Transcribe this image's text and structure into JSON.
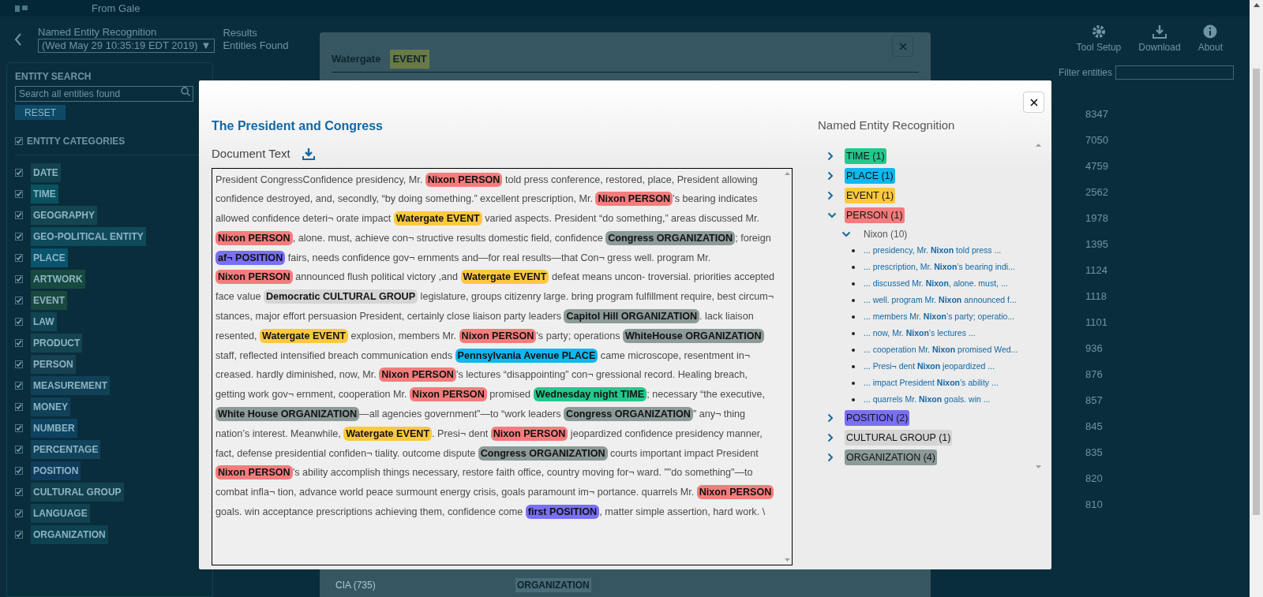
{
  "header": {
    "brand": "From Gale"
  },
  "toolbar": {
    "title": "Named Entity Recognition",
    "date_select": "(Wed May 29 10:35:19 EDT 2019)",
    "date_caret": "▼",
    "results_label": "Results",
    "results_sub": "Entities Found",
    "buttons": [
      {
        "label": "Tool Setup",
        "kind": "gear"
      },
      {
        "label": "Download",
        "kind": "download"
      },
      {
        "label": "About",
        "kind": "info"
      }
    ]
  },
  "sidebar": {
    "search_heading": "ENTITY SEARCH",
    "search": {
      "placeholder": "Search all entities found"
    },
    "reset": "RESET",
    "categories_heading": {
      "label": "ENTITY CATEGORIES",
      "checked": true
    },
    "categories": [
      {
        "label": "DATE",
        "checked": true,
        "color": "#12424c"
      },
      {
        "label": "TIME",
        "checked": true,
        "color": "#0b5261"
      },
      {
        "label": "GEOGRAPHY",
        "checked": true,
        "color": "#14464f"
      },
      {
        "label": "GEO-POLITICAL ENTITY",
        "checked": true,
        "color": "#0e4a5a"
      },
      {
        "label": "PLACE",
        "checked": true,
        "color": "#0a536c"
      },
      {
        "label": "ARTWORK",
        "checked": true,
        "color": "#17493f"
      },
      {
        "label": "EVENT",
        "checked": true,
        "color": "#1a473e"
      },
      {
        "label": "LAW",
        "checked": true,
        "color": "#114452"
      },
      {
        "label": "PRODUCT",
        "checked": true,
        "color": "#14444f"
      },
      {
        "label": "PERSON",
        "checked": true,
        "color": "#174050"
      },
      {
        "label": "MEASUREMENT",
        "checked": true,
        "color": "#114156"
      },
      {
        "label": "MONEY",
        "checked": true,
        "color": "#0f4159"
      },
      {
        "label": "NUMBER",
        "checked": true,
        "color": "#0c425f"
      },
      {
        "label": "PERCENTAGE",
        "checked": true,
        "color": "#11435a"
      },
      {
        "label": "POSITION",
        "checked": true,
        "color": "#0f3b5d"
      },
      {
        "label": "CULTURAL GROUP",
        "checked": true,
        "color": "#13414c"
      },
      {
        "label": "LANGUAGE",
        "checked": true,
        "color": "#12414f"
      },
      {
        "label": "ORGANIZATION",
        "checked": true,
        "color": "#0d4251"
      }
    ]
  },
  "results": {
    "filter_label": "Filter entities",
    "counts": [
      "8347",
      "7050",
      "4759",
      "2562",
      "1978",
      "1395",
      "1124",
      "1118",
      "1101",
      "936",
      "876",
      "857",
      "845",
      "835",
      "820",
      "810"
    ]
  },
  "entity_modal": {
    "title": "Watergate",
    "tag": "EVENT",
    "rows": [
      {
        "name": "CIA (735)",
        "type": "ORGANIZATION"
      }
    ]
  },
  "document_modal": {
    "title": "The President and Congress",
    "section": "Document Text",
    "ner_title": "Named Entity Recognition",
    "segments": [
      {
        "kind": "text",
        "text": "President CongressConfidence presidency, Mr. "
      },
      {
        "kind": "person",
        "text": "Nixon PERSON"
      },
      {
        "kind": "text",
        "text": " told press conference, restored, place, President allowing confidence destroyed, and, secondly, “by doing something.” excellent prescription, Mr. "
      },
      {
        "kind": "person",
        "text": "Nixon PERSON"
      },
      {
        "kind": "text",
        "text": "’s bearing indicates allowed confidence deteri¬ orate impact "
      },
      {
        "kind": "event",
        "text": "Watergate EVENT"
      },
      {
        "kind": "text",
        "text": " varied aspects. President “do something,” areas discussed Mr. "
      },
      {
        "kind": "person",
        "text": "Nixon PERSON"
      },
      {
        "kind": "text",
        "text": ", alone. must, achieve con¬ structive results domestic field, confidence "
      },
      {
        "kind": "organization",
        "text": "Congress ORGANIZATION"
      },
      {
        "kind": "text",
        "text": "; foreign "
      },
      {
        "kind": "position",
        "text": "af¬ POSITION"
      },
      {
        "kind": "text",
        "text": " fairs, needs confidence gov¬ ernments and—for real results—that Con¬ gress well. program Mr. "
      },
      {
        "kind": "person",
        "text": "Nixon PERSON"
      },
      {
        "kind": "text",
        "text": " announced flush political victory ,and "
      },
      {
        "kind": "event",
        "text": "Watergate EVENT"
      },
      {
        "kind": "text",
        "text": " defeat means uncon- troversial. priorities accepted face value "
      },
      {
        "kind": "cultural",
        "text": "Democratic CULTURAL GROUP"
      },
      {
        "kind": "text",
        "text": " legislature, groups citizenry large. bring program fulfillment require, best circum¬ stances, major effort persuasion President, certainly close liaison party leaders "
      },
      {
        "kind": "organization",
        "text": "Capitol Hill ORGANIZATION"
      },
      {
        "kind": "text",
        "text": ". lack liaison resented, "
      },
      {
        "kind": "event",
        "text": "Watergate EVENT"
      },
      {
        "kind": "text",
        "text": " explosion, members Mr. "
      },
      {
        "kind": "person",
        "text": "Nixon PERSON"
      },
      {
        "kind": "text",
        "text": "’s party; operations "
      },
      {
        "kind": "organization",
        "text": "WhiteHouse ORGANIZATION"
      },
      {
        "kind": "text",
        "text": " staff, reflected intensified breach communication ends "
      },
      {
        "kind": "place",
        "text": "Pennsylvania Avenue PLACE"
      },
      {
        "kind": "text",
        "text": " came microscope, resentment in¬ creased. hardly diminished, now, Mr. "
      },
      {
        "kind": "person",
        "text": "Nixon PERSON"
      },
      {
        "kind": "text",
        "text": "’s lectures “disappointing” con¬ gressional record. Healing breach, getting work gov¬ ernment, cooperation Mr. "
      },
      {
        "kind": "person",
        "text": "Nixon PERSON"
      },
      {
        "kind": "text",
        "text": " promised "
      },
      {
        "kind": "time",
        "text": "Wednesday night TIME"
      },
      {
        "kind": "text",
        "text": "; necessary “the executive, "
      },
      {
        "kind": "organization",
        "text": "White House ORGANIZATION"
      },
      {
        "kind": "text",
        "text": "—all agencies government”—to “work leaders "
      },
      {
        "kind": "organization",
        "text": "Congress ORGANIZATION"
      },
      {
        "kind": "text",
        "text": "” any¬ thing nation’s interest. Meanwhile, "
      },
      {
        "kind": "event",
        "text": "Watergate EVENT"
      },
      {
        "kind": "text",
        "text": ". Presi¬ dent "
      },
      {
        "kind": "person",
        "text": "Nixon PERSON"
      },
      {
        "kind": "text",
        "text": " jeopardized confidence presidency manner, fact, defense presidential confiden¬ tiality. outcome dispute "
      },
      {
        "kind": "organization",
        "text": "Congress ORGANIZATION"
      },
      {
        "kind": "text",
        "text": " courts important impact President "
      },
      {
        "kind": "person",
        "text": "Nixon PERSON"
      },
      {
        "kind": "text",
        "text": "’s ability accomplish things necessary, restore faith office, country moving for¬ ward. \"\"do something\"—to combat infla¬ tion, advance world peace surmount energy crisis, goals paramount im¬ portance. quarrels Mr. "
      },
      {
        "kind": "person",
        "text": "Nixon PERSON"
      },
      {
        "kind": "text",
        "text": " goals. win acceptance prescriptions achieving them, confidence come "
      },
      {
        "kind": "position",
        "text": "first POSITION"
      },
      {
        "kind": "text",
        "text": ", matter simple assertion, hard work. \\"
      }
    ],
    "tree": [
      {
        "kind": "time",
        "label": "TIME (1)",
        "expanded": false
      },
      {
        "kind": "place",
        "label": "PLACE (1)",
        "expanded": false
      },
      {
        "kind": "event",
        "label": "EVENT (1)",
        "expanded": false
      },
      {
        "kind": "person",
        "label": "PERSON (1)",
        "expanded": true,
        "children": [
          {
            "kind": "entity",
            "label": "Nixon (10)",
            "expanded": true,
            "children": [
              {
                "kind": "snippet",
                "label": "... presidency, Mr. **Nixon** told press ..."
              },
              {
                "kind": "snippet",
                "label": "... prescription, Mr. **Nixon**’s bearing indi..."
              },
              {
                "kind": "snippet",
                "label": "... discussed Mr. **Nixon**, alone. must, ..."
              },
              {
                "kind": "snippet",
                "label": "... well. program Mr. **Nixon** announced f..."
              },
              {
                "kind": "snippet",
                "label": "... members Mr. **Nixon**’s party; operatio..."
              },
              {
                "kind": "snippet",
                "label": "... now, Mr. **Nixon**’s lectures ..."
              },
              {
                "kind": "snippet",
                "label": "... cooperation Mr. **Nixon** promised Wed..."
              },
              {
                "kind": "snippet",
                "label": "... Presi¬ dent **Nixon** jeopardized ..."
              },
              {
                "kind": "snippet",
                "label": "... impact President **Nixon**’s ability ..."
              },
              {
                "kind": "snippet",
                "label": "... quarrels Mr. **Nixon** goals. win ..."
              }
            ]
          }
        ]
      },
      {
        "kind": "position",
        "label": "POSITION (2)",
        "expanded": false
      },
      {
        "kind": "cultural",
        "label": "CULTURAL GROUP (1)",
        "expanded": false
      },
      {
        "kind": "organization",
        "label": "ORGANIZATION (4)",
        "expanded": false
      }
    ]
  }
}
